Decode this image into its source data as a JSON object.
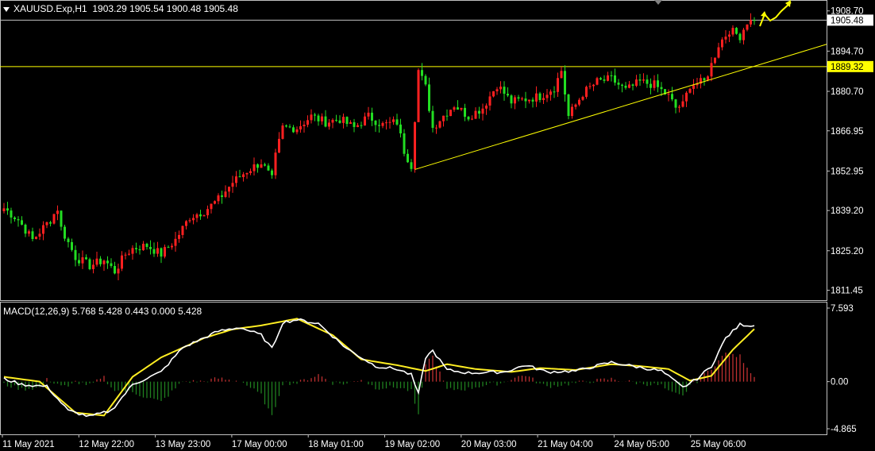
{
  "header": {
    "symbol": "XAUUSD.Exp,H1",
    "ohlc": "1903.29 1905.54 1900.48 1905.48"
  },
  "macd": {
    "label": "MACD(12,26,9) 5.768 5.428 0.443 0.000 5.428",
    "ticks": [
      "7.593",
      "0.00",
      "-4.865"
    ]
  },
  "price_axis": {
    "ticks": [
      "1908.70",
      "1894.70",
      "1880.70",
      "1866.95",
      "1852.95",
      "1839.20",
      "1825.20",
      "1811.45"
    ],
    "current_price": "1905.48",
    "level_price": "1889.32"
  },
  "time_axis": [
    "11 May 2021",
    "12 May 22:00",
    "13 May 23:00",
    "17 May 00:00",
    "18 May 01:00",
    "19 May 02:00",
    "20 May 03:00",
    "21 May 04:00",
    "24 May 05:00",
    "25 May 06:00"
  ],
  "colors": {
    "bull": "#ff2020",
    "bear": "#22dd22",
    "grid": "#c0c0c0",
    "level": "#ffff00",
    "macd_line": "#ffffff",
    "signal_line": "#ffee22",
    "hist_pos": "#c03030",
    "hist_neg": "#208020"
  },
  "chart_data": {
    "type": "candlestick",
    "symbol": "XAUUSD.Exp",
    "timeframe": "H1",
    "y_axis": {
      "min": 1808.0,
      "max": 1912.5
    },
    "horizontal_level": 1889.32,
    "current_price": 1905.48,
    "trendline": {
      "from": [
        115,
        1853.5
      ],
      "to": [
        230,
        1897.0
      ],
      "units": "bar_index, price"
    },
    "bar_count": 205,
    "close_anchors": [
      [
        0,
        1840
      ],
      [
        4,
        1836
      ],
      [
        8,
        1829
      ],
      [
        13,
        1836
      ],
      [
        15,
        1840
      ],
      [
        16,
        1833
      ],
      [
        20,
        1823
      ],
      [
        24,
        1820
      ],
      [
        28,
        1822
      ],
      [
        31,
        1818
      ],
      [
        34,
        1824
      ],
      [
        36,
        1826
      ],
      [
        40,
        1827
      ],
      [
        44,
        1824
      ],
      [
        48,
        1829
      ],
      [
        52,
        1837
      ],
      [
        56,
        1839
      ],
      [
        60,
        1843
      ],
      [
        64,
        1849
      ],
      [
        68,
        1853
      ],
      [
        72,
        1856
      ],
      [
        75,
        1850
      ],
      [
        76,
        1858
      ],
      [
        78,
        1868
      ],
      [
        82,
        1868
      ],
      [
        86,
        1872
      ],
      [
        90,
        1870
      ],
      [
        94,
        1871
      ],
      [
        98,
        1868
      ],
      [
        102,
        1872
      ],
      [
        106,
        1869
      ],
      [
        110,
        1870
      ],
      [
        112,
        1860
      ],
      [
        114,
        1855
      ],
      [
        116,
        1888
      ],
      [
        118,
        1882
      ],
      [
        120,
        1868
      ],
      [
        122,
        1871
      ],
      [
        126,
        1876
      ],
      [
        130,
        1872
      ],
      [
        134,
        1875
      ],
      [
        138,
        1883
      ],
      [
        142,
        1877
      ],
      [
        146,
        1878
      ],
      [
        150,
        1879
      ],
      [
        154,
        1882
      ],
      [
        156,
        1888
      ],
      [
        158,
        1872
      ],
      [
        162,
        1880
      ],
      [
        166,
        1884
      ],
      [
        170,
        1885
      ],
      [
        174,
        1881
      ],
      [
        178,
        1884
      ],
      [
        182,
        1883
      ],
      [
        186,
        1879
      ],
      [
        188,
        1875
      ],
      [
        190,
        1876
      ],
      [
        192,
        1883
      ],
      [
        196,
        1884
      ],
      [
        198,
        1890
      ],
      [
        200,
        1897
      ],
      [
        203,
        1902
      ],
      [
        206,
        1900
      ],
      [
        208,
        1905
      ],
      [
        210,
        1905
      ]
    ],
    "macd_y_axis": {
      "min": -4.865,
      "max": 7.593
    },
    "macd_anchors": [
      [
        0,
        0.3
      ],
      [
        5,
        -0.3
      ],
      [
        12,
        -0.5
      ],
      [
        18,
        -3.0
      ],
      [
        24,
        -3.6
      ],
      [
        30,
        -3.0
      ],
      [
        36,
        -0.3
      ],
      [
        44,
        1.0
      ],
      [
        50,
        3.5
      ],
      [
        60,
        5.2
      ],
      [
        66,
        5.6
      ],
      [
        72,
        4.8
      ],
      [
        75,
        3.4
      ],
      [
        78,
        6.1
      ],
      [
        82,
        6.4
      ],
      [
        88,
        6.0
      ],
      [
        96,
        3.4
      ],
      [
        104,
        1.6
      ],
      [
        110,
        1.3
      ],
      [
        114,
        0.7
      ],
      [
        116,
        -1.3
      ],
      [
        118,
        2.5
      ],
      [
        120,
        3.2
      ],
      [
        124,
        1.2
      ],
      [
        130,
        0.9
      ],
      [
        140,
        1.0
      ],
      [
        146,
        1.7
      ],
      [
        152,
        1.0
      ],
      [
        160,
        1.1
      ],
      [
        170,
        2.0
      ],
      [
        176,
        1.6
      ],
      [
        184,
        1.1
      ],
      [
        190,
        -0.6
      ],
      [
        194,
        0.3
      ],
      [
        198,
        1.6
      ],
      [
        202,
        4.5
      ],
      [
        206,
        5.9
      ],
      [
        210,
        5.77
      ]
    ],
    "signal_anchors": [
      [
        0,
        0.5
      ],
      [
        10,
        0.0
      ],
      [
        20,
        -3.2
      ],
      [
        28,
        -3.5
      ],
      [
        36,
        0.5
      ],
      [
        44,
        2.5
      ],
      [
        56,
        4.5
      ],
      [
        64,
        5.4
      ],
      [
        72,
        5.8
      ],
      [
        82,
        6.5
      ],
      [
        92,
        4.8
      ],
      [
        100,
        2.3
      ],
      [
        110,
        1.7
      ],
      [
        118,
        1.1
      ],
      [
        124,
        1.8
      ],
      [
        132,
        1.3
      ],
      [
        142,
        1.0
      ],
      [
        150,
        1.4
      ],
      [
        160,
        1.2
      ],
      [
        170,
        1.8
      ],
      [
        178,
        1.6
      ],
      [
        186,
        1.3
      ],
      [
        192,
        0.1
      ],
      [
        198,
        0.6
      ],
      [
        204,
        3.3
      ],
      [
        210,
        5.43
      ]
    ]
  }
}
